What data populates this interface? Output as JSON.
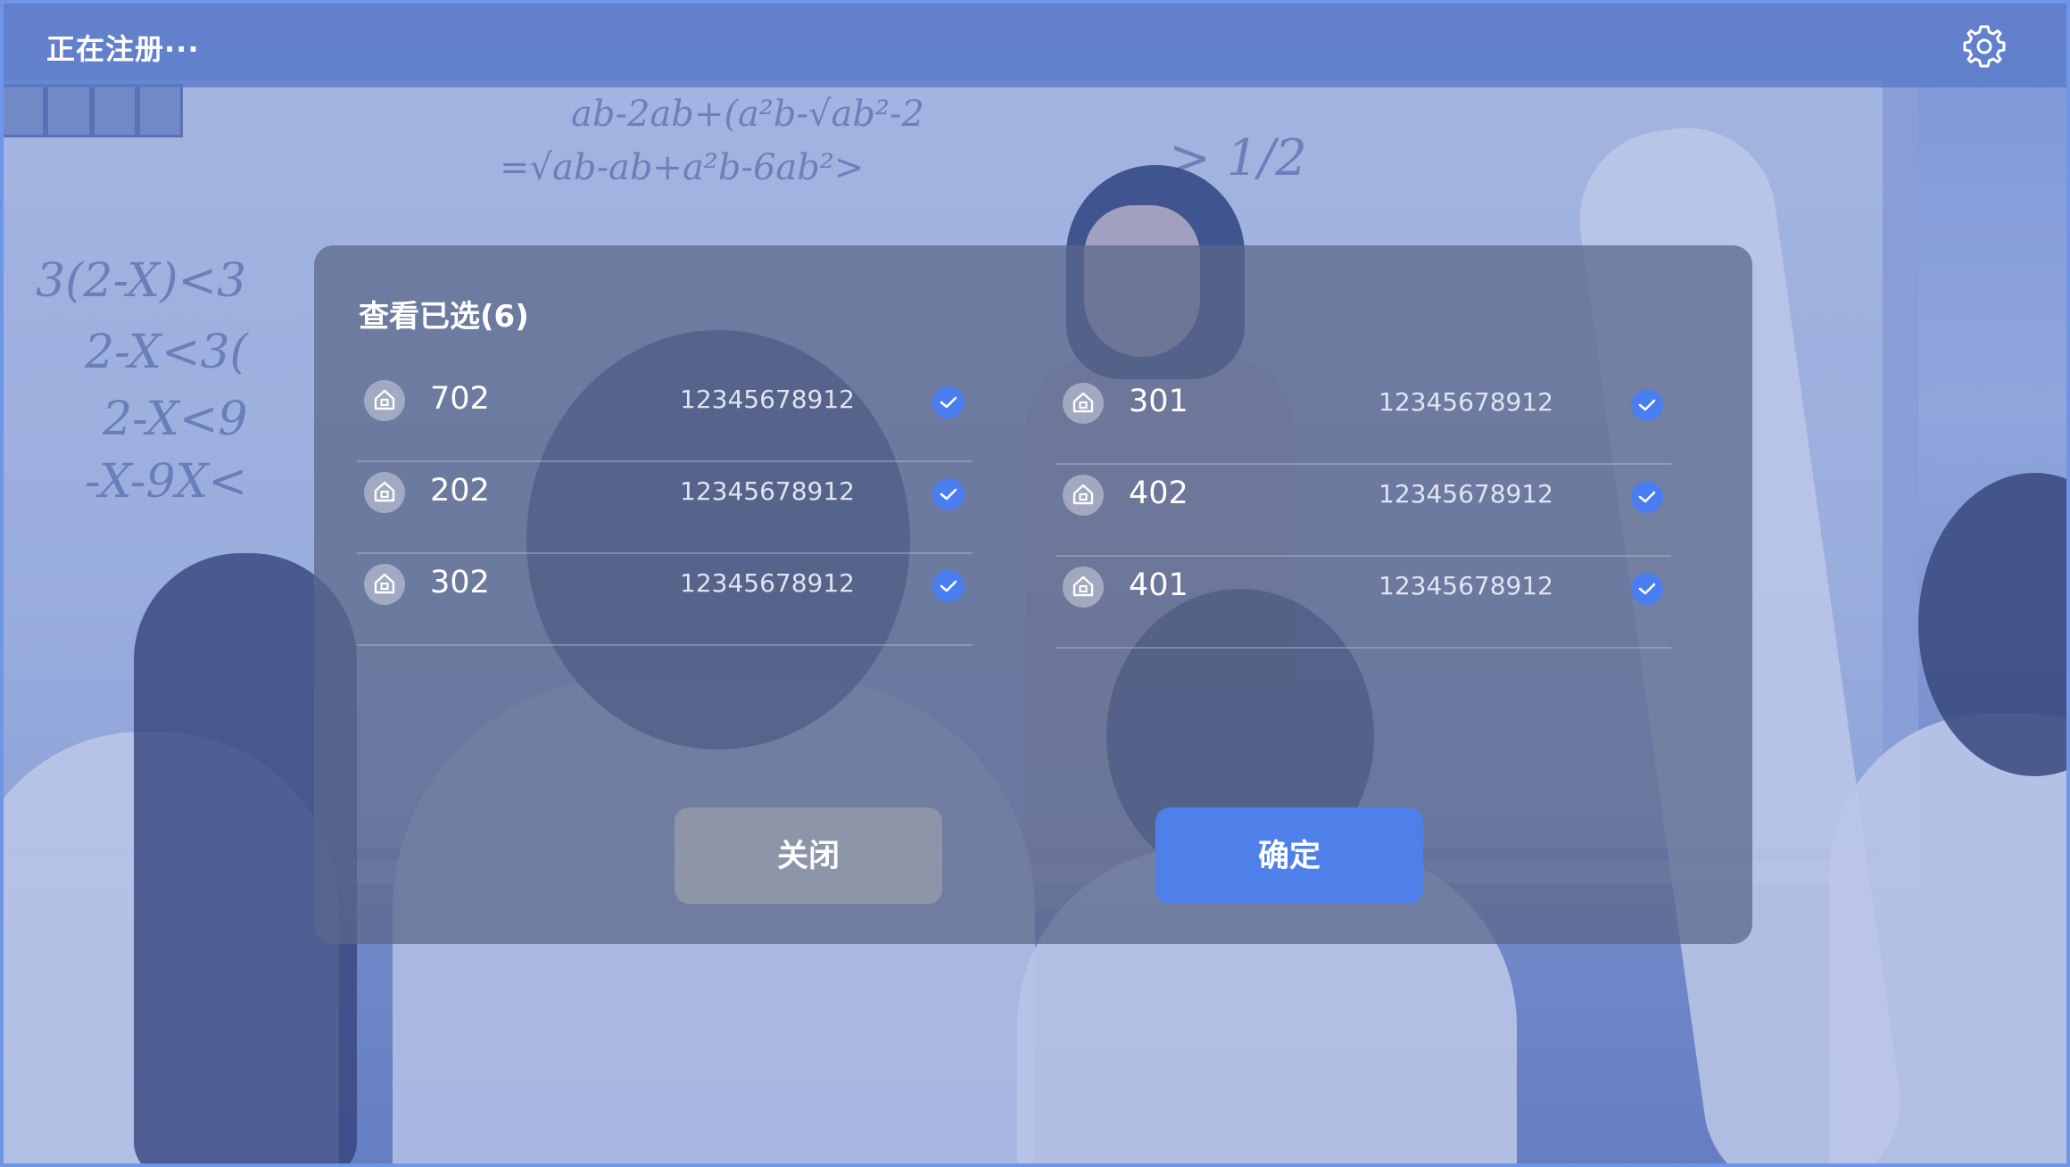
{
  "topbar": {
    "title": "正在注册···",
    "settings_icon": "gear-icon"
  },
  "background": {
    "board_scrawls": [
      "ab-2ab+(a²b-√ab²-2",
      "=√ab-ab+a²b-6ab²>",
      "3(2-X)<3",
      "2-X<3(",
      "2-X<9",
      "-X-9X<",
      "> 1/2"
    ]
  },
  "modal": {
    "title": "查看已选(6)",
    "left_items": [
      {
        "room": "702",
        "phone": "12345678912",
        "selected": true
      },
      {
        "room": "202",
        "phone": "12345678912",
        "selected": true
      },
      {
        "room": "302",
        "phone": "12345678912",
        "selected": true
      }
    ],
    "right_items": [
      {
        "room": "301",
        "phone": "12345678912",
        "selected": true
      },
      {
        "room": "402",
        "phone": "12345678912",
        "selected": true
      },
      {
        "room": "401",
        "phone": "12345678912",
        "selected": true
      }
    ],
    "close_label": "关闭",
    "confirm_label": "确定"
  },
  "colors": {
    "accent": "#4f7fe8",
    "check": "#4a7ef0"
  }
}
